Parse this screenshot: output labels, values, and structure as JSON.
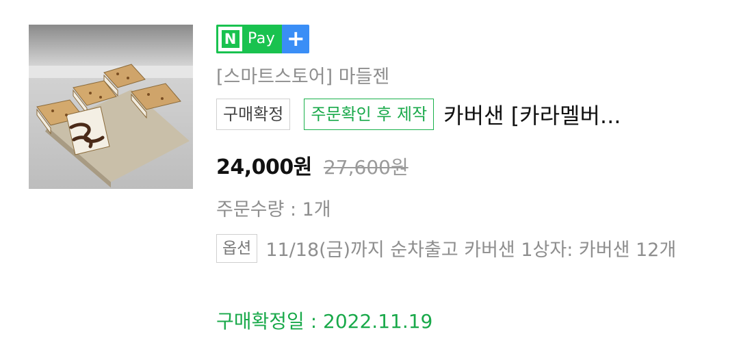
{
  "npay": {
    "n": "N",
    "pay": "Pay",
    "plus": "+"
  },
  "store": "[스마트스토어] 마들젠",
  "badges": {
    "status": "구매확정",
    "production": "주문확인 후 제작"
  },
  "product": {
    "name": "카버샌 [카라멜버...",
    "price": "24,000원",
    "original_price": "27,600원",
    "image_icon": "product-photo"
  },
  "quantity": "주문수량 : 1개",
  "option": {
    "tag": "옵션",
    "text": "11/18(금)까지 순차출고 카버샌 1상자: 카버샌 12개"
  },
  "confirm_date": "구매확정일 : 2022.11.19",
  "colors": {
    "npay_green": "#19c24f",
    "npay_blue": "#3a8ef6",
    "confirm_green": "#19a94a"
  }
}
